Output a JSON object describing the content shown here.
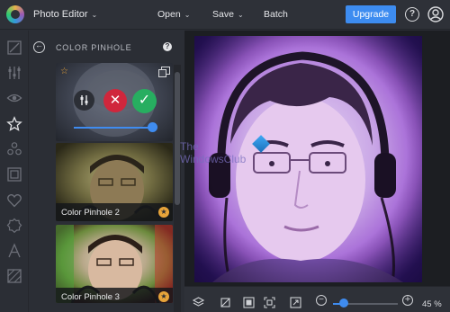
{
  "app": {
    "title": "Photo Editor"
  },
  "menu": {
    "open": "Open",
    "save": "Save",
    "batch": "Batch",
    "upgrade": "Upgrade",
    "help": "?"
  },
  "panel": {
    "title": "COLOR PINHOLE",
    "help": "?",
    "active_effect": {
      "strength": 0.9
    },
    "effects": [
      {
        "label": "Color Pinhole 2",
        "premium": true
      },
      {
        "label": "Color Pinhole 3",
        "premium": true
      }
    ]
  },
  "canvas": {
    "watermark_line1": "The",
    "watermark_line2": "WindowsClub"
  },
  "zoom": {
    "label": "45 %",
    "level": 0.45
  },
  "colors": {
    "accent": "#3d8cf0",
    "cancel": "#d0263c",
    "apply": "#27ae60",
    "favorite": "#e7a43a",
    "photo_tint": "#a56bd6"
  },
  "icons": {
    "strip": [
      "adjust-icon",
      "sliders-icon",
      "eye-icon",
      "star-icon",
      "shapes-icon",
      "frame-icon",
      "heart-icon",
      "badge-icon",
      "text-icon",
      "texture-icon"
    ],
    "bottom": [
      "layers-icon",
      "crop-icon",
      "compare-icon",
      "fit-screen-icon",
      "expand-icon"
    ]
  }
}
